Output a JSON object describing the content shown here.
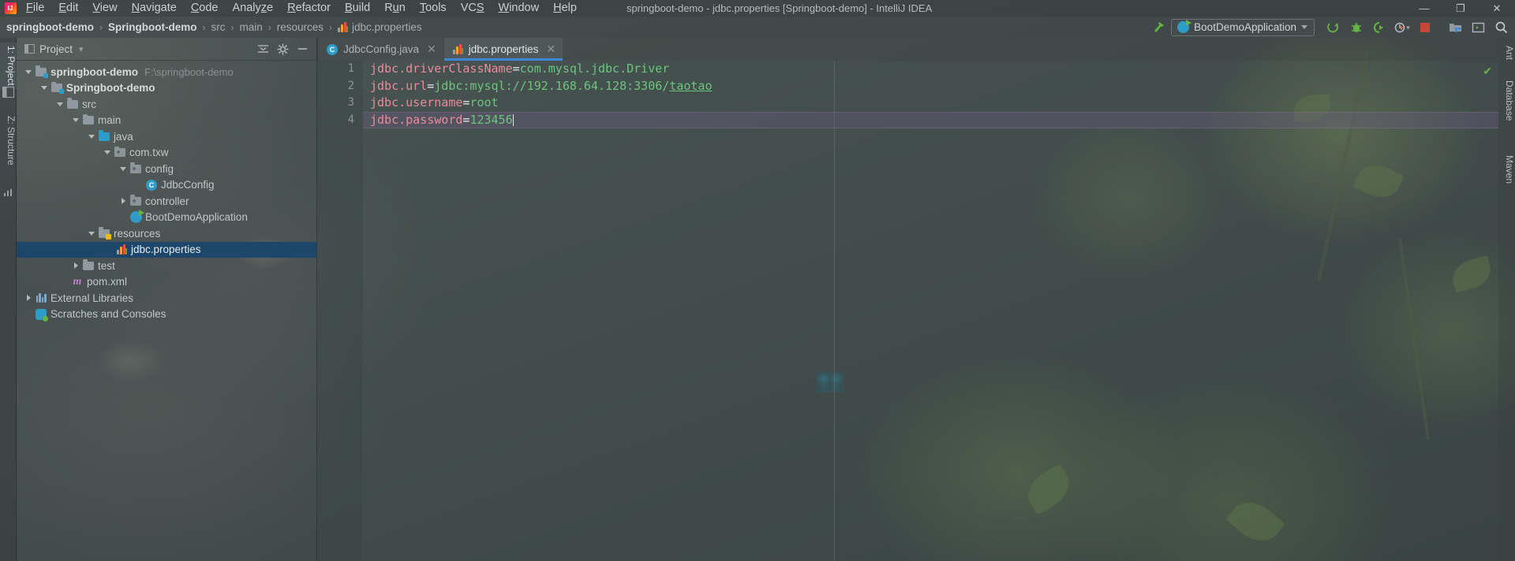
{
  "window": {
    "title": "springboot-demo - jdbc.properties [Springboot-demo] - IntelliJ IDEA",
    "minimize": "—",
    "maximize": "❐",
    "close": "✕",
    "logo_text": "IJ"
  },
  "menu": {
    "items": [
      {
        "label": "File",
        "mnemonic": "F"
      },
      {
        "label": "Edit",
        "mnemonic": "E"
      },
      {
        "label": "View",
        "mnemonic": "V"
      },
      {
        "label": "Navigate",
        "mnemonic": "N"
      },
      {
        "label": "Code",
        "mnemonic": "C"
      },
      {
        "label": "Analyze",
        "mnemonic": "z"
      },
      {
        "label": "Refactor",
        "mnemonic": "R"
      },
      {
        "label": "Build",
        "mnemonic": "B"
      },
      {
        "label": "Run",
        "mnemonic": "u"
      },
      {
        "label": "Tools",
        "mnemonic": "T"
      },
      {
        "label": "VCS",
        "mnemonic": "S"
      },
      {
        "label": "Window",
        "mnemonic": "W"
      },
      {
        "label": "Help",
        "mnemonic": "H"
      }
    ]
  },
  "breadcrumb": {
    "separator": "›",
    "items": [
      "springboot-demo",
      "Springboot-demo",
      "src",
      "main",
      "resources"
    ],
    "file": "jdbc.properties"
  },
  "toolbar": {
    "run_configuration": "BootDemoApplication",
    "buttons": [
      {
        "name": "run-button",
        "glyph": "▶"
      },
      {
        "name": "debug-button",
        "glyph": "✱"
      },
      {
        "name": "run-coverage-button",
        "glyph": "◔"
      },
      {
        "name": "profiler-button",
        "glyph": "◴"
      },
      {
        "name": "stop-button",
        "glyph": "■"
      },
      {
        "name": "project-structure-button",
        "glyph": "▦"
      },
      {
        "name": "terminal-button",
        "glyph": "⌨"
      },
      {
        "name": "search-everywhere-button",
        "glyph": "⚲"
      }
    ],
    "stop_color": "#c9453a",
    "accent_green": "#62b543"
  },
  "left_tool_strip": {
    "items": [
      {
        "label": "1: Project",
        "active": true
      },
      {
        "label": "Z: Structure",
        "active": false
      }
    ]
  },
  "right_tool_strip": {
    "items": [
      {
        "label": "Ant"
      },
      {
        "label": "Database"
      },
      {
        "label": "Maven"
      }
    ]
  },
  "project_panel": {
    "title": "Project",
    "title_caret": "▾",
    "header_buttons": [
      {
        "name": "collapse-all-button",
        "glyph": "⨍"
      },
      {
        "name": "settings-gear-button",
        "glyph": "⚙"
      },
      {
        "name": "hide-panel-button",
        "glyph": "—"
      }
    ],
    "tree": [
      {
        "label": "springboot-demo",
        "path": "F:\\springboot-demo",
        "indent": 0,
        "twisty": "down",
        "icon": "project-folder-icon",
        "bold": true,
        "selected": false
      },
      {
        "label": "Springboot-demo",
        "path": "",
        "indent": 1,
        "twisty": "down",
        "icon": "module-folder-icon",
        "bold": true,
        "selected": false
      },
      {
        "label": "src",
        "path": "",
        "indent": 2,
        "twisty": "down",
        "icon": "folder-icon",
        "bold": false,
        "selected": false
      },
      {
        "label": "main",
        "path": "",
        "indent": 3,
        "twisty": "down",
        "icon": "folder-icon",
        "bold": false,
        "selected": false
      },
      {
        "label": "java",
        "path": "",
        "indent": 4,
        "twisty": "down",
        "icon": "source-folder-icon",
        "bold": false,
        "selected": false
      },
      {
        "label": "com.txw",
        "path": "",
        "indent": 5,
        "twisty": "down",
        "icon": "package-icon",
        "bold": false,
        "selected": false
      },
      {
        "label": "config",
        "path": "",
        "indent": 6,
        "twisty": "down",
        "icon": "package-icon",
        "bold": false,
        "selected": false
      },
      {
        "label": "JdbcConfig",
        "path": "",
        "indent": 7,
        "twisty": "none",
        "icon": "java-class-icon",
        "bold": false,
        "selected": false
      },
      {
        "label": "controller",
        "path": "",
        "indent": 6,
        "twisty": "right",
        "icon": "package-icon",
        "bold": false,
        "selected": false
      },
      {
        "label": "BootDemoApplication",
        "path": "",
        "indent": 6,
        "twisty": "none",
        "icon": "spring-application-icon",
        "bold": false,
        "selected": false
      },
      {
        "label": "resources",
        "path": "",
        "indent": 4,
        "twisty": "down",
        "icon": "resources-folder-icon",
        "bold": false,
        "selected": false
      },
      {
        "label": "jdbc.properties",
        "path": "",
        "indent": 5,
        "twisty": "none",
        "icon": "properties-file-icon",
        "bold": false,
        "selected": true
      },
      {
        "label": "test",
        "path": "",
        "indent": 3,
        "twisty": "right",
        "icon": "folder-icon",
        "bold": false,
        "selected": false
      },
      {
        "label": "pom.xml",
        "path": "",
        "indent": 3,
        "twisty": "none",
        "icon": "maven-icon",
        "bold": false,
        "selected": false
      },
      {
        "label": "External Libraries",
        "path": "",
        "indent": 1,
        "twisty": "right",
        "icon": "library-icon",
        "bold": false,
        "selected": false
      },
      {
        "label": "Scratches and Consoles",
        "path": "",
        "indent": 1,
        "twisty": "none",
        "icon": "scratches-icon",
        "bold": false,
        "selected": false
      }
    ],
    "selected_row_color": "#1d466b"
  },
  "editor": {
    "tabs": [
      {
        "label": "JdbcConfig.java",
        "icon": "java-class-icon",
        "active": false,
        "close": "✕"
      },
      {
        "label": "jdbc.properties",
        "icon": "properties-file-icon",
        "active": true,
        "close": "✕"
      }
    ],
    "active_tab_underline": "#3d87d6",
    "line_numbers": [
      "1",
      "2",
      "3",
      "4"
    ],
    "lines": [
      {
        "number": "1",
        "key": "jdbc.driverClassName",
        "eq": "=",
        "value": "com.mysql.jdbc.Driver",
        "underlined_value": "",
        "current": false
      },
      {
        "number": "2",
        "key": "jdbc.url",
        "eq": "=",
        "value": "jdbc:mysql://192.168.64.128:3306/",
        "underlined_value": "taotao",
        "current": false
      },
      {
        "number": "3",
        "key": "jdbc.username",
        "eq": "=",
        "value": "root",
        "underlined_value": "",
        "current": false
      },
      {
        "number": "4",
        "key": "jdbc.password",
        "eq": "=",
        "value": "123456",
        "underlined_value": "",
        "current": true
      }
    ],
    "key_color": "#e88b9d",
    "value_color": "#6cc47e",
    "current_line_highlight": "#6e5c82",
    "inspection_status": "✔"
  }
}
